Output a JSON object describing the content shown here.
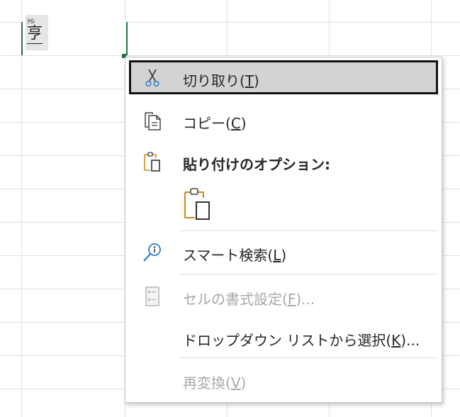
{
  "cell": {
    "ruby": "ﾃｲﾚ",
    "kanji": "亨"
  },
  "menu": {
    "cut": {
      "label": "切り取り(",
      "key": "T",
      "tail": ")"
    },
    "copy": {
      "label": "コピー(",
      "key": "C",
      "tail": ")"
    },
    "paste_options": {
      "label": "貼り付けのオプション:"
    },
    "smart_lookup": {
      "label": "スマート検索(",
      "key": "L",
      "tail": ")"
    },
    "format_cells": {
      "label": "セルの書式設定(",
      "key": "F",
      "tail": ")..."
    },
    "dropdown_list": {
      "label": "ドロップダウン リストから選択(",
      "key": "K",
      "tail": ")..."
    },
    "reconvert": {
      "label": "再変換(",
      "key": "V",
      "tail": ")"
    }
  },
  "colors": {
    "accent_green": "#217346",
    "paste_orange": "#d08a1e",
    "lookup_blue": "#2b7cd3",
    "scissors_blue": "#3a7fc4"
  },
  "icons": [
    "scissors-icon",
    "copy-icon",
    "clipboard-icon",
    "paste-icon",
    "smart-lookup-icon",
    "format-cells-icon"
  ]
}
